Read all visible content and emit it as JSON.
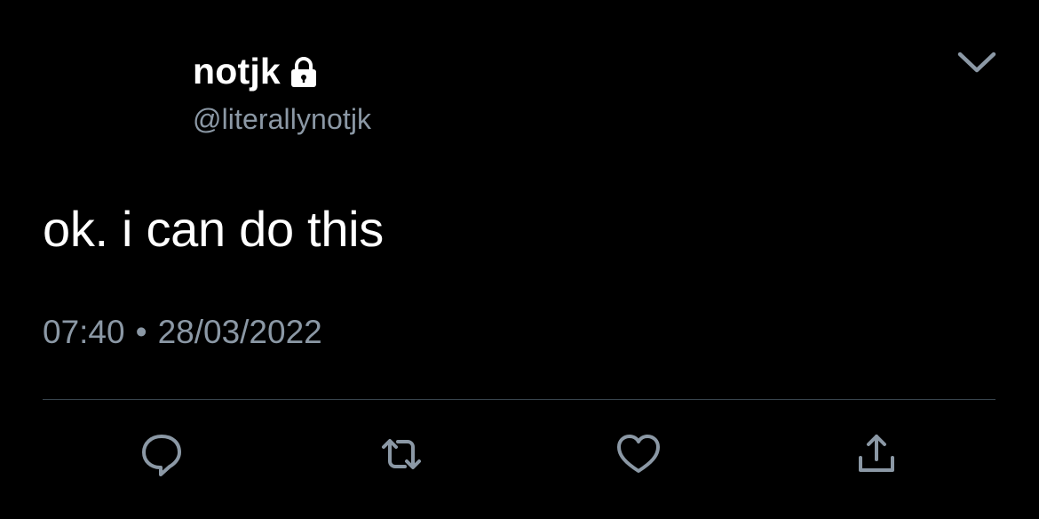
{
  "tweet": {
    "display_name": "notjk",
    "handle": "@literallynotjk",
    "text": "ok. i can do this",
    "time": "07:40",
    "separator": "•",
    "date": "28/03/2022"
  },
  "icons": {
    "lock": "lock-icon",
    "caret": "chevron-down-icon",
    "reply": "reply-icon",
    "retweet": "retweet-icon",
    "like": "heart-icon",
    "share": "share-icon"
  },
  "colors": {
    "background": "#000000",
    "primary_text": "#ffffff",
    "secondary_text": "#8b98a5",
    "icon": "#8b98a5",
    "divider": "#38444d"
  }
}
